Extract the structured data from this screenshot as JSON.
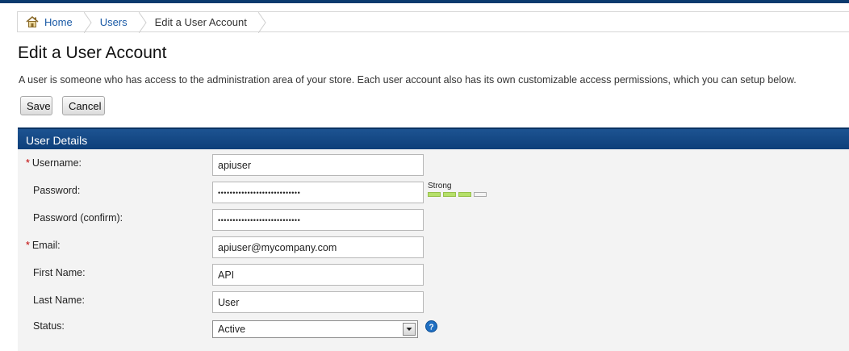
{
  "breadcrumb": {
    "home": "Home",
    "users": "Users",
    "current": "Edit a User Account"
  },
  "page": {
    "title": "Edit a User Account",
    "intro": "A user is someone who has access to the administration area of your store. Each user account also has its own customizable access permissions, which you can setup below."
  },
  "toolbar": {
    "save_label": "Save",
    "cancel_label": "Cancel"
  },
  "panel": {
    "title": "User Details"
  },
  "form": {
    "username": {
      "label": "Username:",
      "value": "apiuser",
      "required": true
    },
    "password": {
      "label": "Password:",
      "value": "••••••••••••••••••••••••••••"
    },
    "password_confirm": {
      "label": "Password (confirm):",
      "value": "••••••••••••••••••••••••••••"
    },
    "email": {
      "label": "Email:",
      "value": "apiuser@mycompany.com",
      "required": true
    },
    "first_name": {
      "label": "First Name:",
      "value": "API"
    },
    "last_name": {
      "label": "Last Name:",
      "value": "User"
    },
    "status": {
      "label": "Status:",
      "value": "Active"
    }
  },
  "password_strength": {
    "label": "Strong",
    "level": 3,
    "max": 4
  },
  "required_marker": "*",
  "colors": {
    "accent": "#0d3f7a",
    "link": "#1a5aa6",
    "required": "#c00000",
    "strength_on": "#b5e06a"
  },
  "icons": {
    "home": "home-icon",
    "help": "help-icon",
    "dropdown": "chevron-down-icon"
  }
}
